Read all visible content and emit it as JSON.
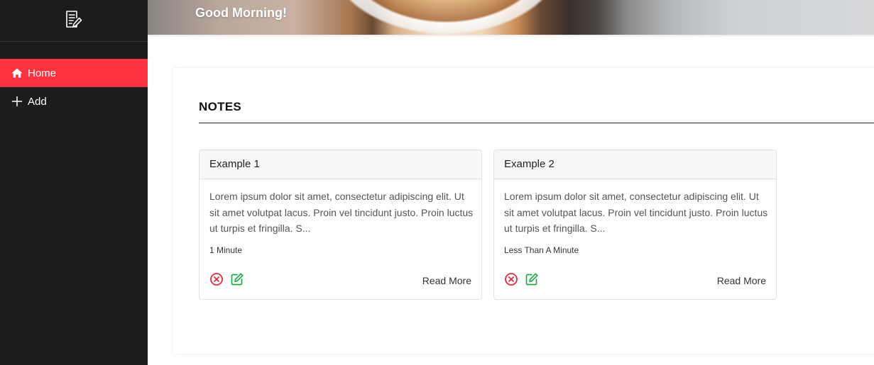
{
  "sidebar": {
    "logo_icon": "notes-icon",
    "items": [
      {
        "label": "Home",
        "icon": "home-icon",
        "active": true
      },
      {
        "label": "Add",
        "icon": "plus-icon",
        "active": false
      }
    ]
  },
  "header": {
    "greeting": "Good Morning!"
  },
  "notes": {
    "title": "NOTES",
    "cards": [
      {
        "title": "Example 1",
        "body": "Lorem ipsum dolor sit amet, consectetur adipiscing elit. Ut sit amet volutpat lacus. Proin vel tincidunt justo. Proin luctus ut turpis et fringilla. S...",
        "time": "1 Minute",
        "read_more": "Read More"
      },
      {
        "title": "Example 2",
        "body": "Lorem ipsum dolor sit amet, consectetur adipiscing elit. Ut sit amet volutpat lacus. Proin vel tincidunt justo. Proin luctus ut turpis et fringilla. S...",
        "time": "Less Than A Minute",
        "read_more": "Read More"
      }
    ]
  },
  "colors": {
    "sidebar_bg": "#1c1c1c",
    "active_item": "#ff333f",
    "delete_icon": "#e8293b",
    "edit_icon": "#1ca94a"
  }
}
